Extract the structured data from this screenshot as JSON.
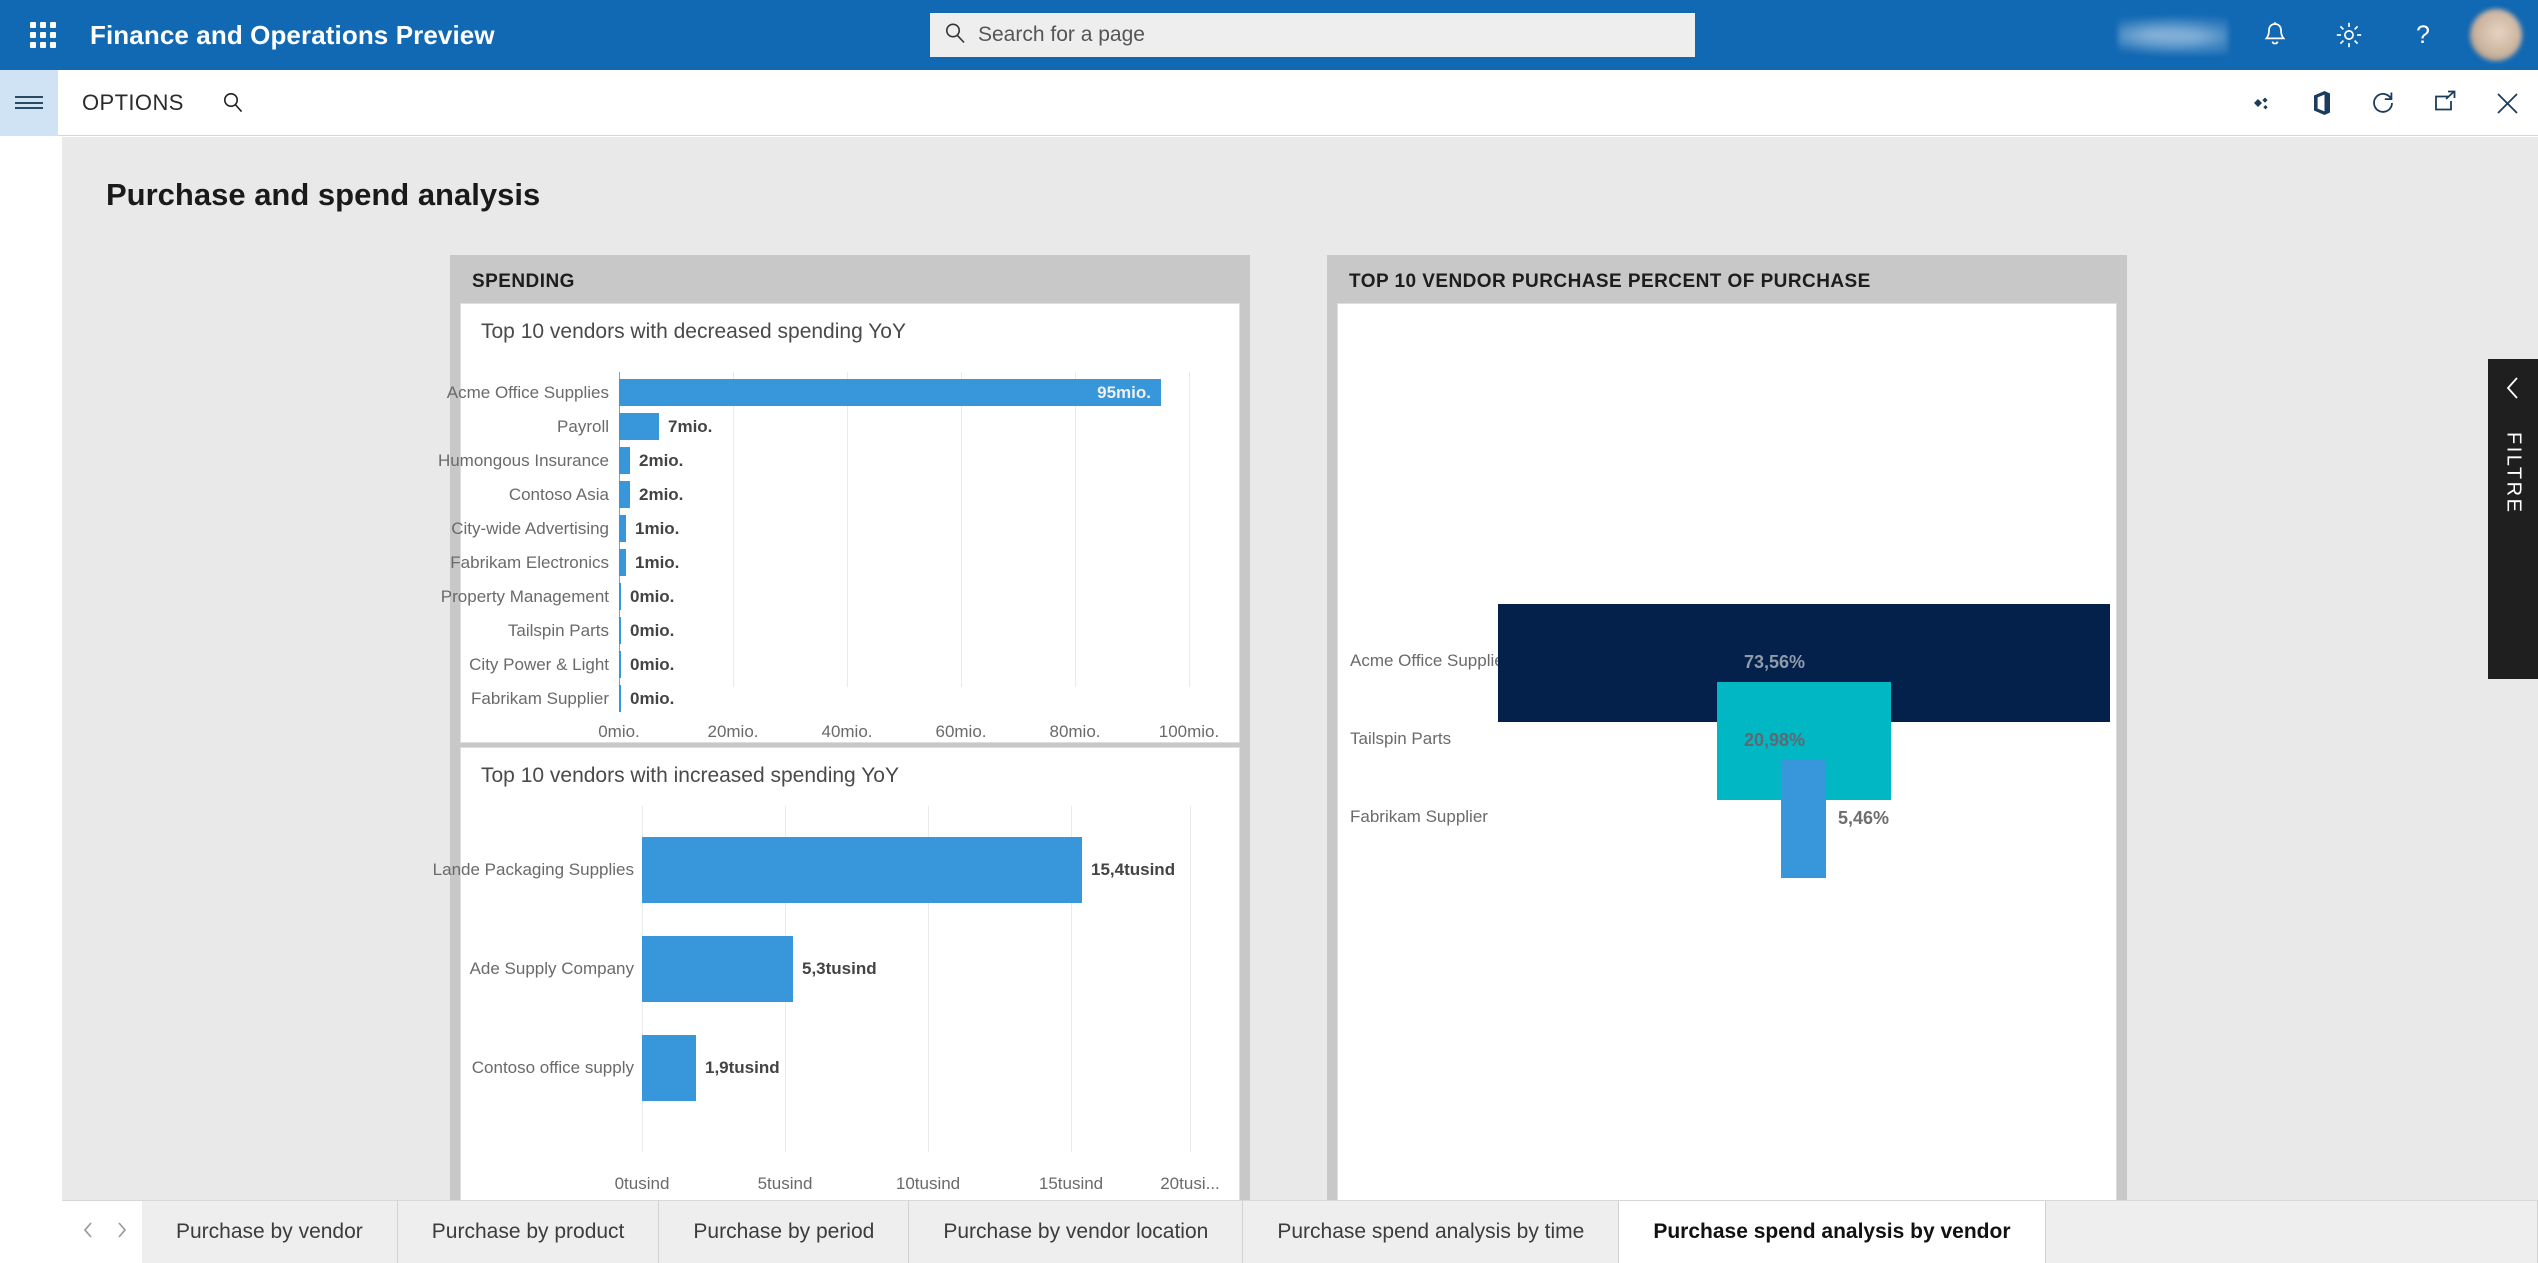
{
  "topbar": {
    "app_title": "Finance and Operations Preview",
    "waffle_icon": "app-launcher-icon",
    "search": {
      "placeholder": "Search for a page",
      "value": "",
      "icon": "search-icon"
    },
    "icons": [
      "company-name-blurred",
      "notifications-bell-icon",
      "settings-gear-icon",
      "help-question-icon",
      "user-avatar"
    ]
  },
  "optionsbar": {
    "menu_icon": "hamburger-menu-icon",
    "options_label": "OPTIONS",
    "search_icon": "search-icon",
    "right_icons": [
      "personalize-icon",
      "office-app-icon",
      "refresh-icon",
      "open-in-new-window-icon",
      "close-icon"
    ]
  },
  "page": {
    "title": "Purchase and spend analysis"
  },
  "panels": {
    "spending": {
      "header": "SPENDING",
      "tiles": [
        {
          "title": "Top 10 vendors with decreased spending YoY"
        },
        {
          "title": "Top 10 vendors with increased spending YoY"
        }
      ]
    },
    "vendor_percent": {
      "header": "TOP 10 VENDOR PURCHASE PERCENT OF PURCHASE"
    }
  },
  "filter_flyout": {
    "label": "FILTRE",
    "chevron_icon": "chevron-left-icon"
  },
  "tabbar": {
    "prev_icon": "chevron-left-icon",
    "next_icon": "chevron-right-icon",
    "tabs": [
      {
        "label": "Purchase by vendor",
        "active": false
      },
      {
        "label": "Purchase by product",
        "active": false
      },
      {
        "label": "Purchase by period",
        "active": false
      },
      {
        "label": "Purchase by vendor location",
        "active": false
      },
      {
        "label": "Purchase spend analysis by time",
        "active": false
      },
      {
        "label": "Purchase spend analysis by vendor",
        "active": true
      }
    ]
  },
  "colors": {
    "header_blue": "#1168b3",
    "bar_blue": "#3896db",
    "funnel_navy": "#04214c",
    "funnel_teal": "#00b7c3",
    "funnel_blue": "#3896db",
    "workspace_bg": "#e9e9e9",
    "panel_bg": "#c8c8c8"
  },
  "chart_data": [
    {
      "type": "bar",
      "orientation": "horizontal",
      "title": "Top 10 vendors with decreased spending YoY",
      "categories": [
        "Acme Office Supplies",
        "Payroll",
        "Humongous Insurance",
        "Contoso Asia",
        "City-wide Advertising",
        "Fabrikam Electronics",
        "Property Management",
        "Tailspin Parts",
        "City Power & Light",
        "Fabrikam Supplier"
      ],
      "values": [
        95,
        7,
        2,
        2,
        1,
        1,
        0,
        0,
        0,
        0
      ],
      "data_labels": [
        "95mio.",
        "7mio.",
        "2mio.",
        "2mio.",
        "1mio.",
        "1mio.",
        "0mio.",
        "0mio.",
        "0mio.",
        "0mio."
      ],
      "xticks": [
        "0mio.",
        "20mio.",
        "40mio.",
        "60mio.",
        "80mio.",
        "100mio."
      ],
      "xtick_values": [
        0,
        20,
        40,
        60,
        80,
        100
      ],
      "xlim": [
        0,
        110
      ],
      "xlabel": "",
      "ylabel": "",
      "grid": true,
      "legend": false,
      "series_color": "#3896db"
    },
    {
      "type": "bar",
      "orientation": "horizontal",
      "title": "Top 10 vendors with increased spending YoY",
      "categories": [
        "Lande Packaging Supplies",
        "Ade Supply Company",
        "Contoso office supply"
      ],
      "values": [
        15.4,
        5.3,
        1.9
      ],
      "data_labels": [
        "15,4tusind",
        "5,3tusind",
        "1,9tusind"
      ],
      "xticks": [
        "0tusind",
        "5tusind",
        "10tusind",
        "15tusind",
        "20tusi..."
      ],
      "xtick_values": [
        0,
        5,
        10,
        15,
        20
      ],
      "xlim": [
        0,
        21.5
      ],
      "xlabel": "",
      "ylabel": "",
      "grid": true,
      "legend": false,
      "series_color": "#3896db"
    },
    {
      "type": "bar",
      "orientation": "funnel",
      "title": "TOP 10 VENDOR PURCHASE PERCENT OF PURCHASE",
      "categories": [
        "Acme Office Supplies",
        "Tailspin Parts",
        "Fabrikam Supplier"
      ],
      "values": [
        73.56,
        20.98,
        5.46
      ],
      "data_labels": [
        "73,56%",
        "20,98%",
        "5,46%"
      ],
      "colors": [
        "#04214c",
        "#00b7c3",
        "#3896db"
      ],
      "xlabel": "",
      "ylabel": "",
      "grid": false,
      "legend": false
    }
  ]
}
